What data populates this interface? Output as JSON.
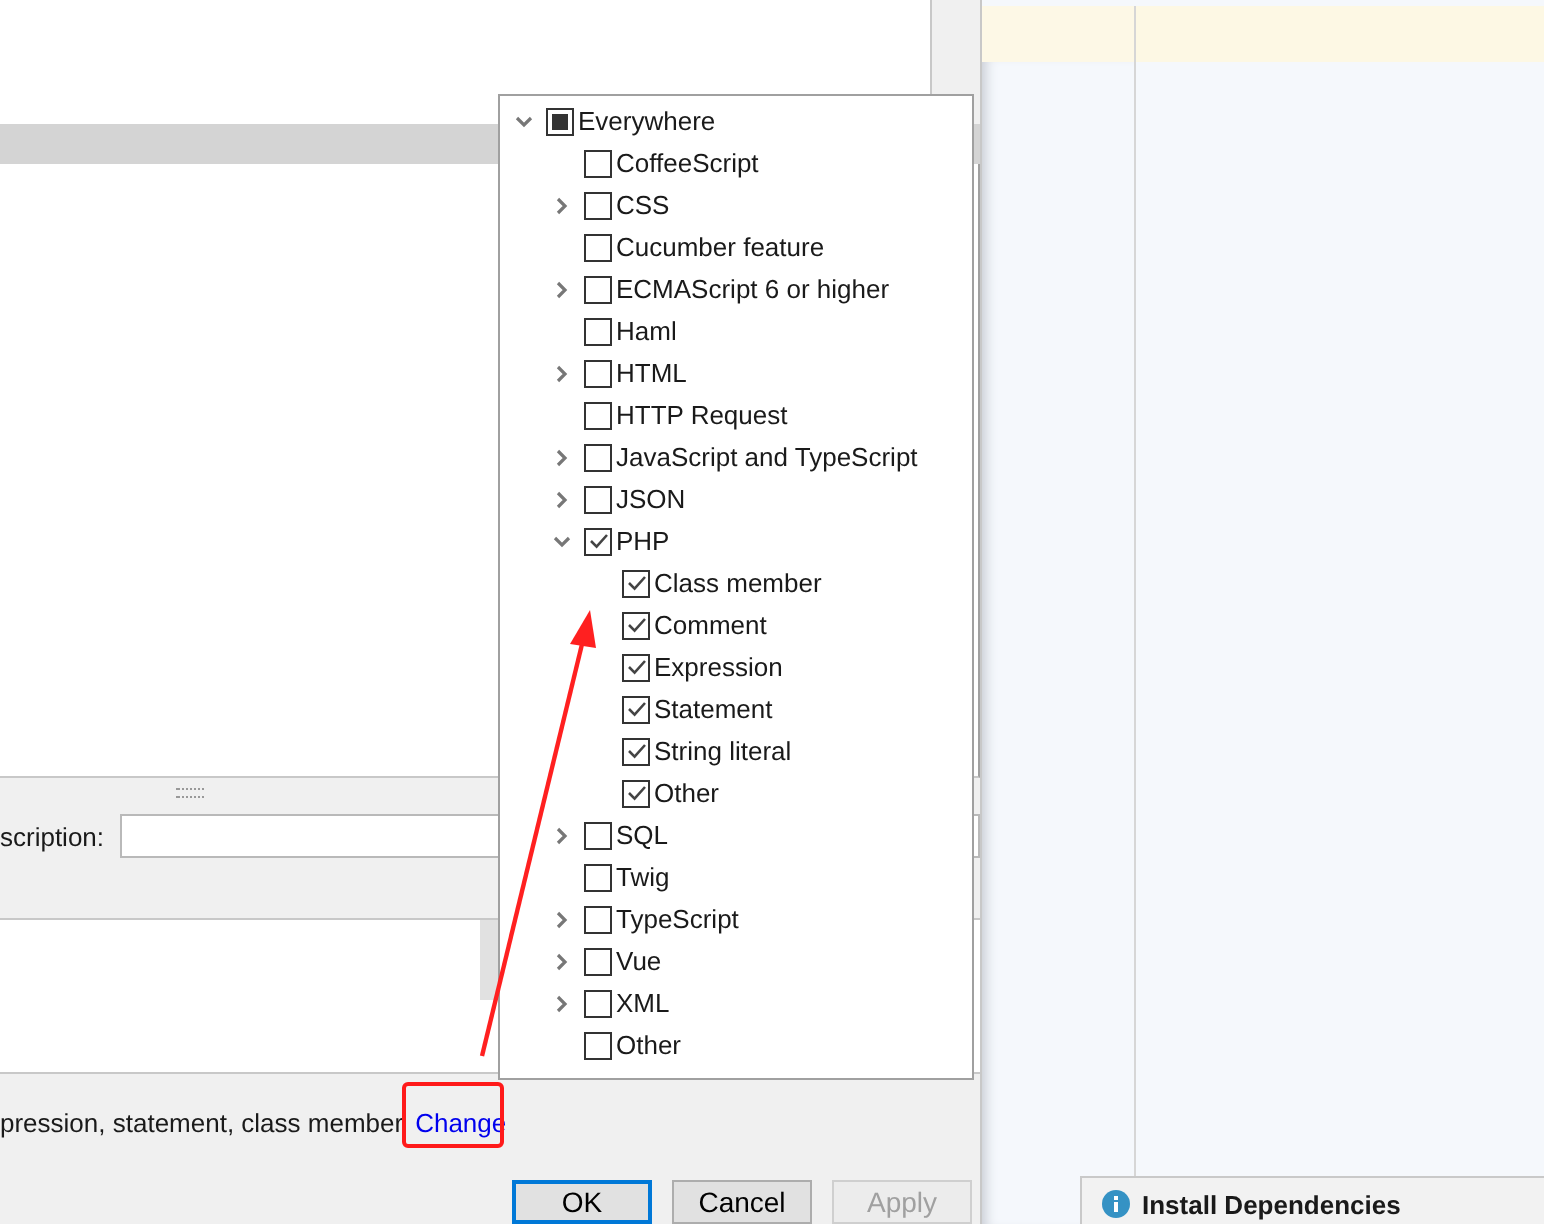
{
  "dialog": {
    "description_label": "scription:",
    "context_text": "pression, statement, class member",
    "change_link": "Change",
    "buttons": [
      {
        "label": "OK",
        "kind": "default",
        "disabled": false
      },
      {
        "label": "Cancel",
        "kind": "normal",
        "disabled": false
      },
      {
        "label": "Apply",
        "kind": "normal",
        "disabled": true
      }
    ]
  },
  "context_popup": {
    "tree": [
      {
        "label": "Everywhere",
        "checked": true,
        "partial": true,
        "expandable": true,
        "expanded": true,
        "children": [
          {
            "label": "CoffeeScript",
            "checked": false,
            "expandable": false
          },
          {
            "label": "CSS",
            "checked": false,
            "expandable": true,
            "expanded": false
          },
          {
            "label": "Cucumber feature",
            "checked": false,
            "expandable": false
          },
          {
            "label": "ECMAScript 6 or higher",
            "checked": false,
            "expandable": true,
            "expanded": false
          },
          {
            "label": "Haml",
            "checked": false,
            "expandable": false
          },
          {
            "label": "HTML",
            "checked": false,
            "expandable": true,
            "expanded": false
          },
          {
            "label": "HTTP Request",
            "checked": false,
            "expandable": false
          },
          {
            "label": "JavaScript and TypeScript",
            "checked": false,
            "expandable": true,
            "expanded": false
          },
          {
            "label": "JSON",
            "checked": false,
            "expandable": true,
            "expanded": false
          },
          {
            "label": "PHP",
            "checked": true,
            "expandable": true,
            "expanded": true,
            "children": [
              {
                "label": "Class member",
                "checked": true,
                "expandable": false
              },
              {
                "label": "Comment",
                "checked": true,
                "expandable": false
              },
              {
                "label": "Expression",
                "checked": true,
                "expandable": false
              },
              {
                "label": "Statement",
                "checked": true,
                "expandable": false
              },
              {
                "label": "String literal",
                "checked": true,
                "expandable": false
              },
              {
                "label": "Other",
                "checked": true,
                "expandable": false
              }
            ]
          },
          {
            "label": "SQL",
            "checked": false,
            "expandable": true,
            "expanded": false
          },
          {
            "label": "Twig",
            "checked": false,
            "expandable": false
          },
          {
            "label": "TypeScript",
            "checked": false,
            "expandable": true,
            "expanded": false
          },
          {
            "label": "Vue",
            "checked": false,
            "expandable": true,
            "expanded": false
          },
          {
            "label": "XML",
            "checked": false,
            "expandable": true,
            "expanded": false
          },
          {
            "label": "Other",
            "checked": false,
            "expandable": false
          }
        ]
      }
    ]
  },
  "notification": {
    "text": "Install Dependencies"
  }
}
